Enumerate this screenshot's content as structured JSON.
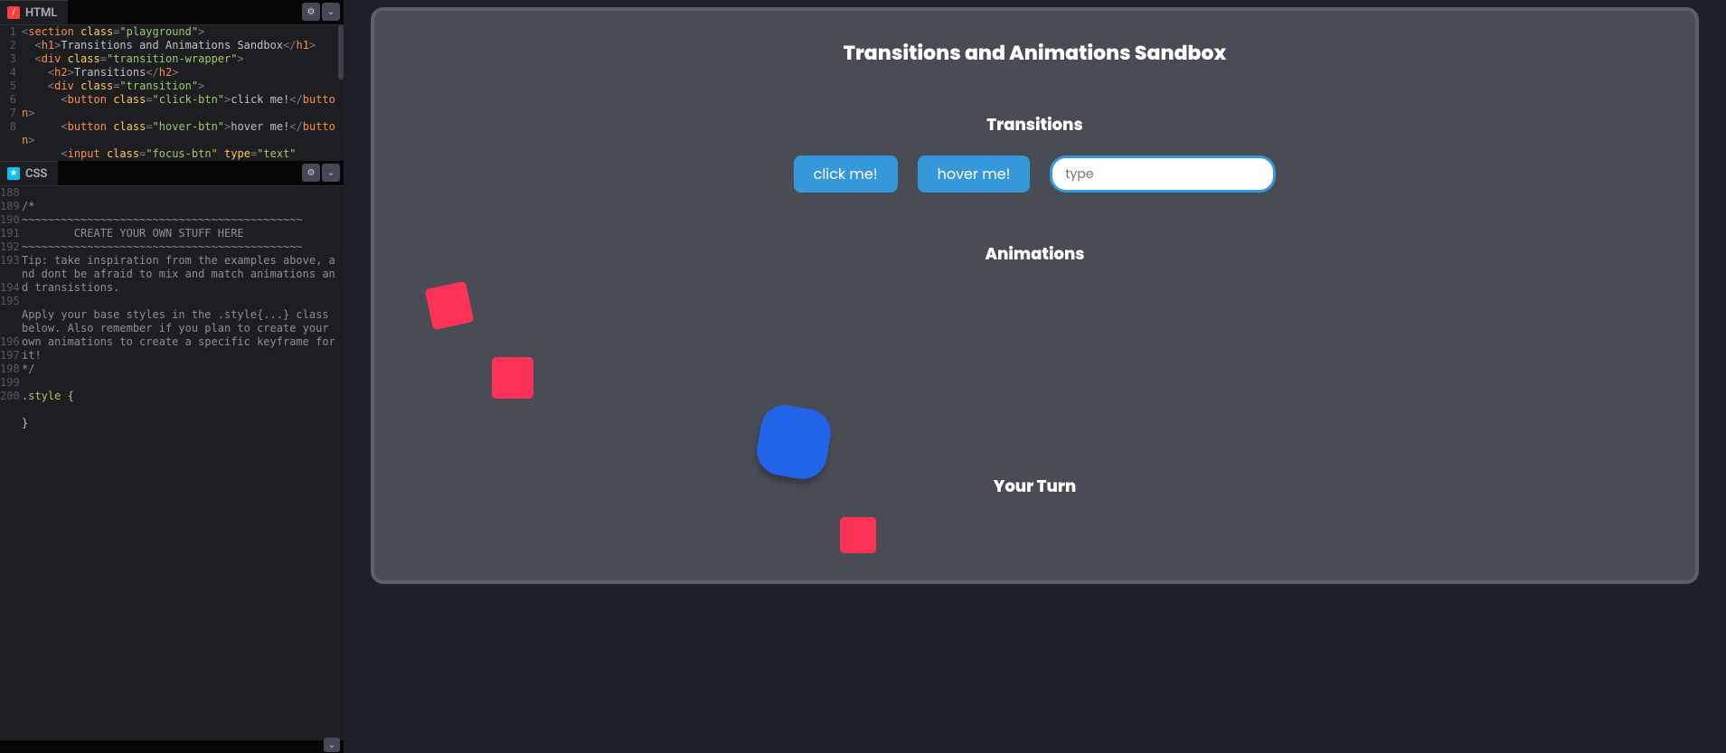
{
  "panels": {
    "html": {
      "label": "HTML"
    },
    "css": {
      "label": "CSS"
    }
  },
  "html_lines": [
    "1",
    "2",
    "3",
    "4",
    "5",
    "6",
    "7",
    "8"
  ],
  "html_code": {
    "l1": "<section class=\"playground\">",
    "l2": "  <h1>Transitions and Animations Sandbox</h1>",
    "l3": "  <div class=\"transition-wrapper\">",
    "l4": "    <h2>Transitions</h2>",
    "l5": "    <div class=\"transition\">",
    "l6": "      <button class=\"click-btn\">click me!</button>",
    "l7": "      <button class=\"hover-btn\">hover me!</button>",
    "l8": "      <input class=\"focus-btn\" type=\"text\""
  },
  "css_lines": [
    "188",
    "189",
    "190",
    "191",
    "192",
    "193",
    "194",
    "195",
    "196",
    "197",
    "198",
    "199",
    "200"
  ],
  "css_code": {
    "c189": "/*",
    "c190": "~~~~~~~~~~~~~~~~~~~~~~~~~~~~~~~~~~~~~~~~~~~",
    "c191": "        CREATE YOUR OWN STUFF HERE",
    "c192": "~~~~~~~~~~~~~~~~~~~~~~~~~~~~~~~~~~~~~~~~~~~",
    "c193": "Tip: take inspiration from the examples above, and dont be afraid to mix and match animations and transistions.",
    "c195": "Apply your base styles in the .style{...} class below. Also remember if you plan to create your own animations to create a specific keyframe for it!",
    "c196": "*/",
    "c198": ".style {",
    "c200": "}"
  },
  "preview": {
    "title": "Transitions and Animations Sandbox",
    "h2_transitions": "Transitions",
    "h2_animations": "Animations",
    "h2_yourturn": "Your Turn",
    "click_label": "click me!",
    "hover_label": "hover me!",
    "input_placeholder": "type"
  }
}
